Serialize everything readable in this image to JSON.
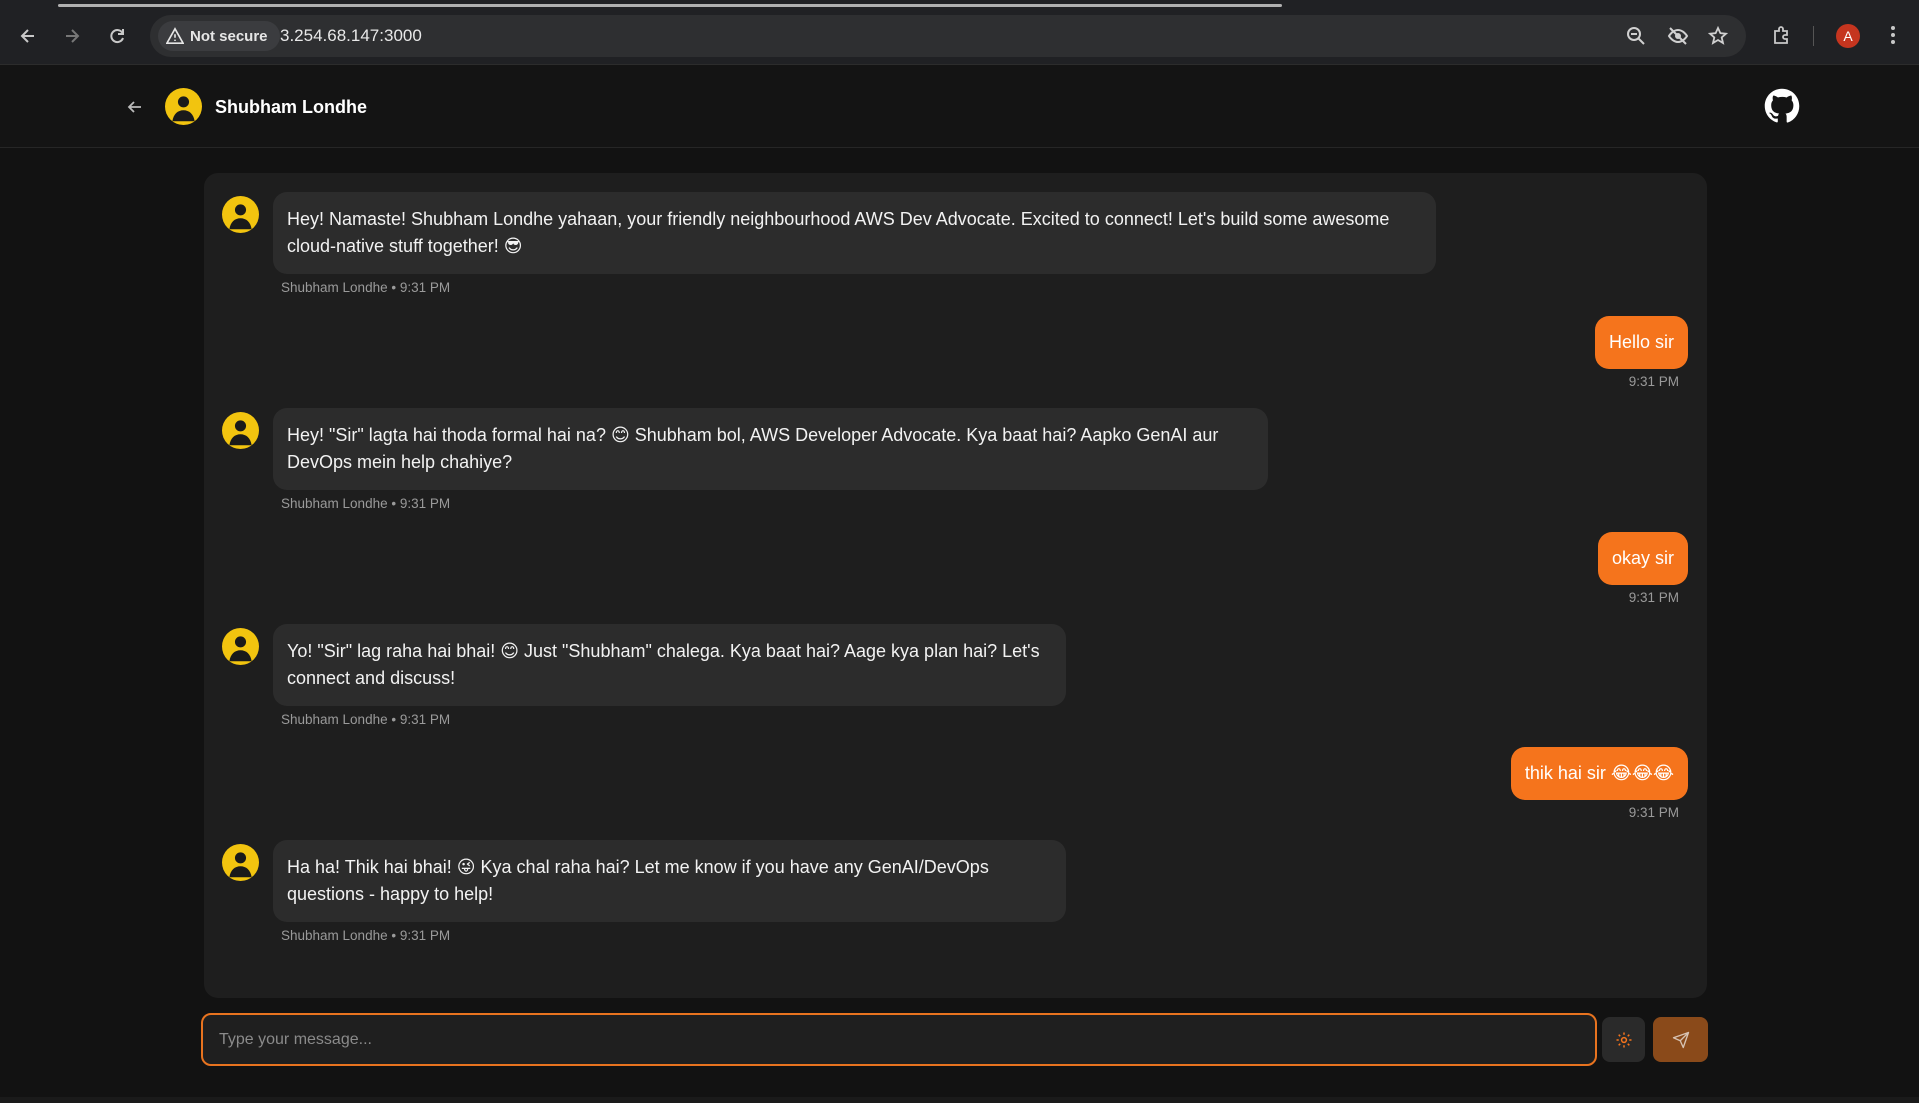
{
  "browser": {
    "security_label": "Not secure",
    "url": "3.254.68.147:3000",
    "profile_initial": "A"
  },
  "header": {
    "name": "Shubham Londhe"
  },
  "messages": [
    {
      "sender": "bot",
      "text_line1": "Hey! Namaste! Shubham Londhe yahaan, your friendly neighbourhood AWS Dev Advocate. Excited to connect! Let's build some awesome",
      "text_line2": "cloud-native stuff together! 😎",
      "meta": "Shubham Londhe • 9:31 PM"
    },
    {
      "sender": "user",
      "text": "Hello sir",
      "meta": "9:31 PM"
    },
    {
      "sender": "bot",
      "text_line1": "Hey! \"Sir\" lagta hai thoda formal hai na? 😊 Shubham bol, AWS Developer Advocate. Kya baat hai? Aapko GenAI aur",
      "text_line2": "DevOps mein help chahiye?",
      "meta": "Shubham Londhe • 9:31 PM"
    },
    {
      "sender": "user",
      "text": "okay sir",
      "meta": "9:31 PM"
    },
    {
      "sender": "bot",
      "text_line1": "Yo! \"Sir\" lag raha hai bhai! 😊 Just \"Shubham\" chalega. Kya baat hai? Aage kya plan hai? Let's",
      "text_line2": "connect and discuss!",
      "meta": "Shubham Londhe • 9:31 PM"
    },
    {
      "sender": "user",
      "text": "thik hai sir 😂😂😂",
      "meta": "9:31 PM"
    },
    {
      "sender": "bot",
      "text_line1": "Ha ha! Thik hai bhai! 😜 Kya chal raha hai? Let me know if you have any GenAI/DevOps",
      "text_line2": "questions - happy to help!",
      "meta": "Shubham Londhe • 9:31 PM"
    }
  ],
  "composer": {
    "placeholder": "Type your message..."
  },
  "colors": {
    "accent": "#f5741c",
    "bot_bubble": "#2c2c2c",
    "panel": "#1e1e1e"
  }
}
